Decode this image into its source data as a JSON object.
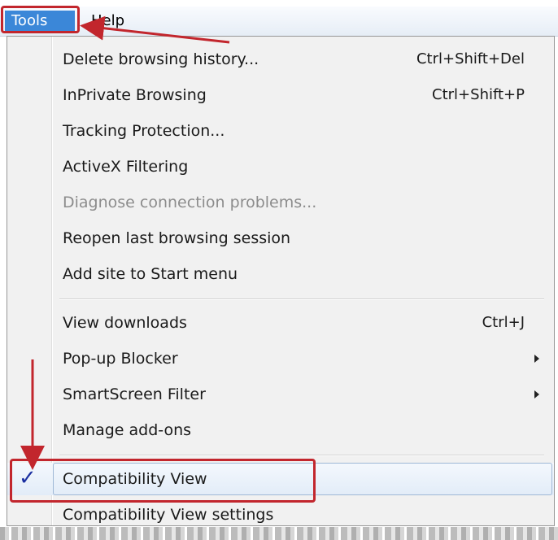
{
  "menubar": {
    "items": [
      {
        "label": "Tools"
      },
      {
        "label": "Help"
      }
    ]
  },
  "tools_menu": {
    "groups": [
      [
        {
          "label": "Delete browsing history...",
          "shortcut": "Ctrl+Shift+Del"
        },
        {
          "label": "InPrivate Browsing",
          "shortcut": "Ctrl+Shift+P"
        },
        {
          "label": "Tracking Protection..."
        },
        {
          "label": "ActiveX Filtering"
        },
        {
          "label": "Diagnose connection problems...",
          "disabled": true
        },
        {
          "label": "Reopen last browsing session"
        },
        {
          "label": "Add site to Start menu"
        }
      ],
      [
        {
          "label": "View downloads",
          "shortcut": "Ctrl+J"
        },
        {
          "label": "Pop-up Blocker",
          "submenu": true
        },
        {
          "label": "SmartScreen Filter",
          "submenu": true
        },
        {
          "label": "Manage add-ons"
        }
      ],
      [
        {
          "label": "Compatibility View",
          "checked": true,
          "highlighted": true
        },
        {
          "label": "Compatibility View settings"
        }
      ]
    ]
  },
  "colors": {
    "menu_background": "#f1f1f1",
    "menubar_active": "#3b87d8",
    "annotation": "#c2262d",
    "checkmark": "#1b2fa0",
    "disabled_text": "#8c8c8c"
  },
  "icons": {
    "check": "check-icon",
    "submenu": "chevron-right-icon"
  }
}
